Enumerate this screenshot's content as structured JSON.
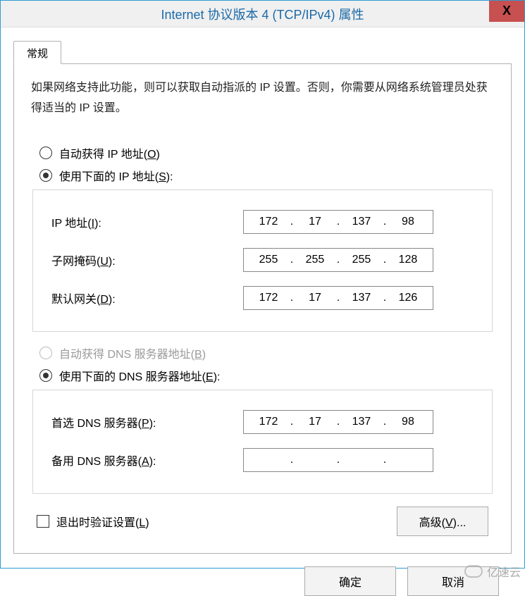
{
  "title": "Internet 协议版本 4 (TCP/IPv4) 属性",
  "close_glyph": "X",
  "tab_label": "常规",
  "description": "如果网络支持此功能，则可以获取自动指派的 IP 设置。否则，你需要从网络系统管理员处获得适当的 IP 设置。",
  "ip_section": {
    "auto_label_pre": "自动获得 IP 地址(",
    "auto_key": "O",
    "auto_label_post": ")",
    "manual_label_pre": "使用下面的 IP 地址(",
    "manual_key": "S",
    "manual_label_post": "):",
    "selected": "manual",
    "fields": {
      "ip_label_pre": "IP 地址(",
      "ip_key": "I",
      "ip_label_post": "):",
      "ip": [
        "172",
        "17",
        "137",
        "98"
      ],
      "mask_label_pre": "子网掩码(",
      "mask_key": "U",
      "mask_label_post": "):",
      "mask": [
        "255",
        "255",
        "255",
        "128"
      ],
      "gw_label_pre": "默认网关(",
      "gw_key": "D",
      "gw_label_post": "):",
      "gw": [
        "172",
        "17",
        "137",
        "126"
      ]
    }
  },
  "dns_section": {
    "auto_label_pre": "自动获得 DNS 服务器地址(",
    "auto_key": "B",
    "auto_label_post": ")",
    "auto_disabled": true,
    "manual_label_pre": "使用下面的 DNS 服务器地址(",
    "manual_key": "E",
    "manual_label_post": "):",
    "selected": "manual",
    "fields": {
      "pref_label_pre": "首选 DNS 服务器(",
      "pref_key": "P",
      "pref_label_post": "):",
      "pref": [
        "172",
        "17",
        "137",
        "98"
      ],
      "alt_label_pre": "备用 DNS 服务器(",
      "alt_key": "A",
      "alt_label_post": "):",
      "alt": [
        "",
        "",
        "",
        ""
      ]
    }
  },
  "validate_label_pre": "退出时验证设置(",
  "validate_key": "L",
  "validate_label_post": ")",
  "advanced_label_pre": "高级(",
  "advanced_key": "V",
  "advanced_label_post": ")...",
  "ok_label": "确定",
  "cancel_label": "取消",
  "watermark": "亿速云"
}
